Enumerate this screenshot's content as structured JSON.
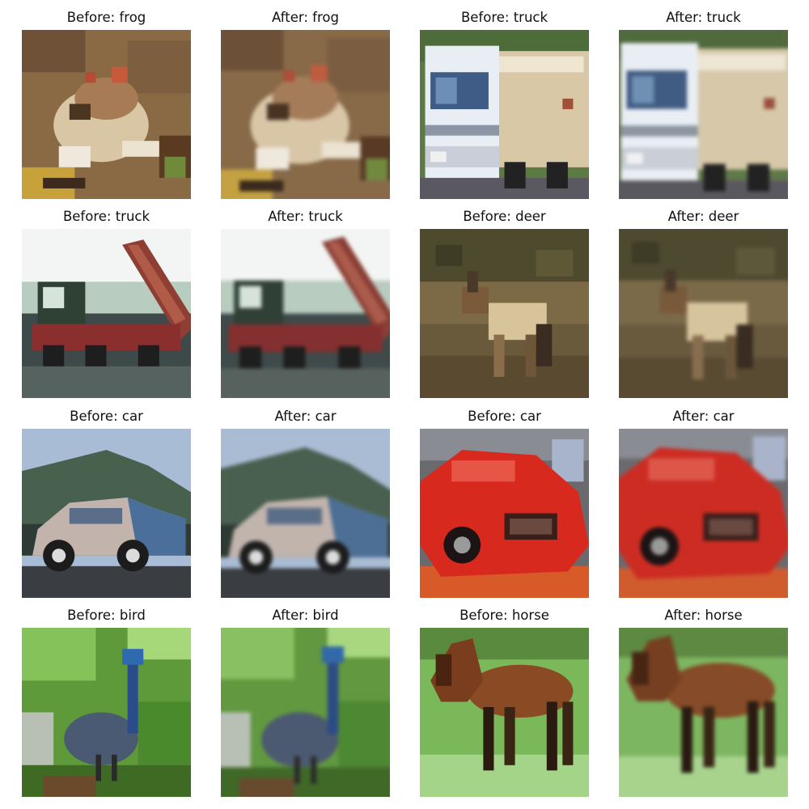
{
  "panels": [
    {
      "caption": "Before: frog",
      "subject": "frog",
      "stage": "before"
    },
    {
      "caption": "After: frog",
      "subject": "frog",
      "stage": "after"
    },
    {
      "caption": "Before: truck",
      "subject": "truck1",
      "stage": "before"
    },
    {
      "caption": "After: truck",
      "subject": "truck1",
      "stage": "after"
    },
    {
      "caption": "Before: truck",
      "subject": "truck2",
      "stage": "before"
    },
    {
      "caption": "After: truck",
      "subject": "truck2",
      "stage": "after"
    },
    {
      "caption": "Before: deer",
      "subject": "deer",
      "stage": "before"
    },
    {
      "caption": "After: deer",
      "subject": "deer",
      "stage": "after"
    },
    {
      "caption": "Before: car",
      "subject": "car1",
      "stage": "before"
    },
    {
      "caption": "After: car",
      "subject": "car1",
      "stage": "after"
    },
    {
      "caption": "Before: car",
      "subject": "car2",
      "stage": "before"
    },
    {
      "caption": "After: car",
      "subject": "car2",
      "stage": "after"
    },
    {
      "caption": "Before: bird",
      "subject": "bird",
      "stage": "before"
    },
    {
      "caption": "After: bird",
      "subject": "bird",
      "stage": "after"
    },
    {
      "caption": "Before: horse",
      "subject": "horse",
      "stage": "before"
    },
    {
      "caption": "After: horse",
      "subject": "horse",
      "stage": "after"
    }
  ]
}
